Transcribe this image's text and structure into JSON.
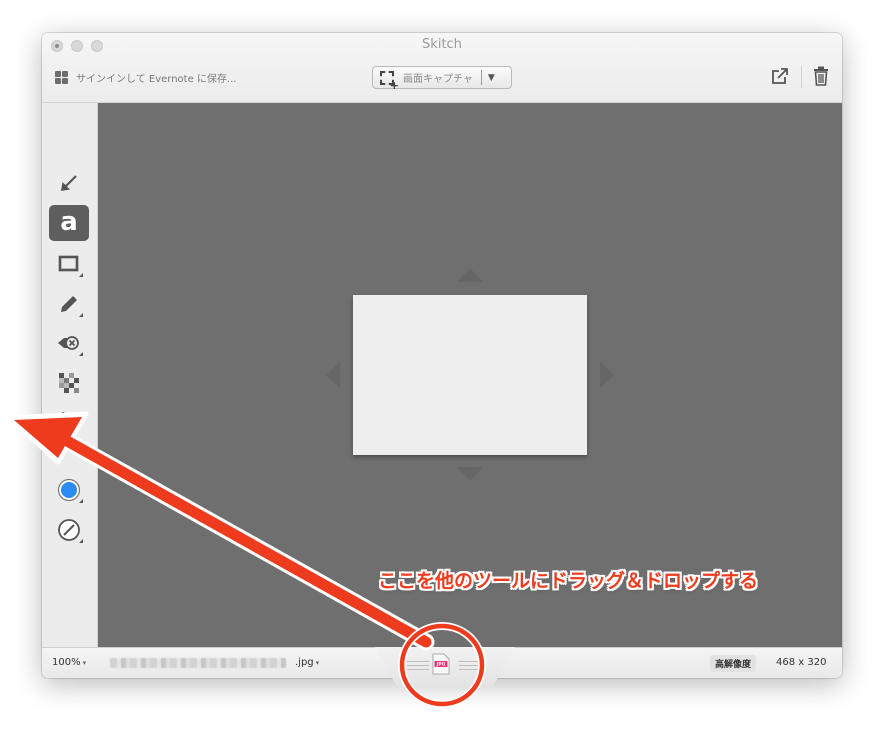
{
  "window": {
    "title": "Skitch"
  },
  "titlebar": {
    "signin_label": "サインインして Evernote に保存...",
    "capture_label": "画面キャプチャ",
    "capture_dropdown_glyph": "▼"
  },
  "tools": [
    {
      "name": "arrow-tool",
      "icon": "arrow-icon",
      "selected": false
    },
    {
      "name": "text-tool",
      "icon": "text-a-icon",
      "label": "a",
      "selected": true
    },
    {
      "name": "rectangle-tool",
      "icon": "rectangle-icon",
      "selected": false
    },
    {
      "name": "pen-tool",
      "icon": "pen-icon",
      "selected": false
    },
    {
      "name": "stamp-tool",
      "icon": "stamp-icon",
      "selected": false
    },
    {
      "name": "pixelate-tool",
      "icon": "pixelate-icon",
      "selected": false
    },
    {
      "name": "crop-tool",
      "icon": "crop-icon",
      "selected": false
    },
    {
      "name": "color-picker",
      "icon": "color-dot-icon",
      "selected": false
    },
    {
      "name": "stroke-width-picker",
      "icon": "stroke-width-icon",
      "selected": false
    }
  ],
  "statusbar": {
    "zoom": "100%",
    "caret": "▾",
    "file_extension": ".jpg",
    "resolution_badge": "高解像度",
    "dimensions": "468 x 320",
    "drag_file_badge": "JPG"
  },
  "annotation": {
    "text": "ここを他のツールにドラッグ＆ドロップする"
  },
  "colors": {
    "accent_blue": "#2a8bf2",
    "annotation_red": "#ee3a1d",
    "canvas_gray": "#6f6f6f",
    "paper": "#eeeeee",
    "jpg_pink": "#e8367a"
  }
}
